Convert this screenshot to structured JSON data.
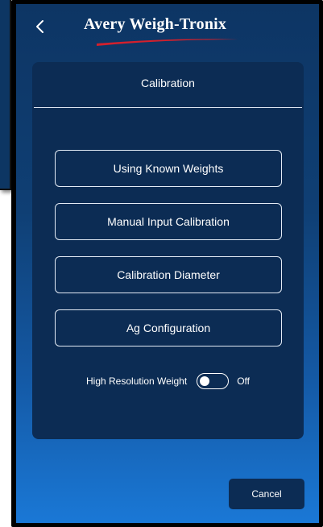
{
  "header": {
    "back_icon": "chevron-left-icon",
    "brand_name": "Avery Weigh-Tronix"
  },
  "panel": {
    "title": "Calibration",
    "options": [
      {
        "label": "Using Known Weights"
      },
      {
        "label": "Manual Input Calibration"
      },
      {
        "label": "Calibration Diameter"
      },
      {
        "label": "Ag Configuration"
      }
    ],
    "high_resolution": {
      "label": "High Resolution Weight",
      "state": "Off",
      "enabled": false
    }
  },
  "footer": {
    "cancel_label": "Cancel"
  },
  "colors": {
    "panel": "#0c2c54",
    "background_top": "#0d3564",
    "background_bottom": "#1a78d6",
    "brand_swoosh": "#d4202c",
    "text": "#ffffff"
  }
}
